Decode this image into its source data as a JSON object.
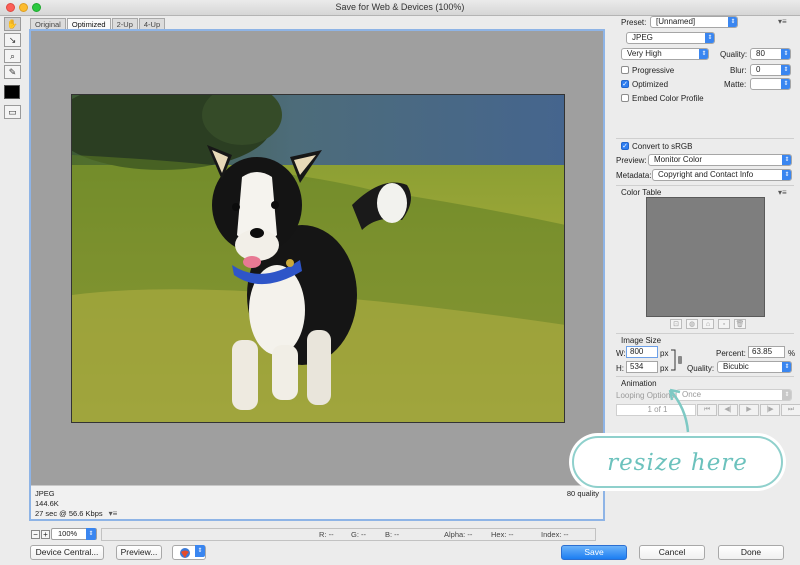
{
  "window": {
    "title": "Save for Web & Devices (100%)"
  },
  "tools": [
    {
      "name": "hand-tool-icon",
      "glyph": "✋"
    },
    {
      "name": "slice-select-tool-icon",
      "glyph": "↘"
    },
    {
      "name": "zoom-tool-icon",
      "glyph": "⌕"
    },
    {
      "name": "eyedropper-tool-icon",
      "glyph": "✎"
    }
  ],
  "eyedropper_color": "#000000",
  "view_tabs": [
    "Original",
    "Optimized",
    "2-Up",
    "4-Up"
  ],
  "active_tab": "Optimized",
  "image_info": {
    "format": "JPEG",
    "size": "144.6K",
    "time": "27 sec @ 56.6 Kbps",
    "quality": "80 quality"
  },
  "status": {
    "zoom": "100%",
    "r": "R: --",
    "g": "G: --",
    "b": "B: --",
    "alpha": "Alpha: --",
    "hex": "Hex: --",
    "index": "Index: --"
  },
  "buttons": {
    "device_central": "Device Central...",
    "preview": "Preview...",
    "save": "Save",
    "cancel": "Cancel",
    "done": "Done"
  },
  "settings": {
    "preset_label": "Preset:",
    "preset_value": "[Unnamed]",
    "format": "JPEG",
    "quality_preset": "Very High",
    "quality_label": "Quality:",
    "quality_value": "80",
    "blur_label": "Blur:",
    "blur_value": "0",
    "matte_label": "Matte:",
    "progressive_label": "Progressive",
    "progressive_checked": false,
    "optimized_label": "Optimized",
    "optimized_checked": true,
    "embed_profile_label": "Embed Color Profile",
    "embed_profile_checked": false,
    "convert_srgb_label": "Convert to sRGB",
    "convert_srgb_checked": true,
    "preview_label": "Preview:",
    "preview_value": "Monitor Color",
    "metadata_label": "Metadata:",
    "metadata_value": "Copyright and Contact Info"
  },
  "color_table": {
    "title": "Color Table"
  },
  "image_size": {
    "title": "Image Size",
    "w_label": "W:",
    "w_value": "800",
    "h_label": "H:",
    "h_value": "534",
    "unit": "px",
    "percent_label": "Percent:",
    "percent_value": "63.85",
    "percent_unit": "%",
    "quality_label": "Quality:",
    "quality_value": "Bicubic"
  },
  "animation": {
    "title": "Animation",
    "looping_label": "Looping Options:",
    "looping_value": "Once",
    "frame_counter": "1 of 1"
  },
  "annotation": {
    "text": "resize here",
    "color": "#6cc2bd"
  },
  "colors": {
    "accent": "#2f7ff2",
    "canvas_border": "#8eb4e6",
    "canvas_bg": "#9f9f9f"
  }
}
